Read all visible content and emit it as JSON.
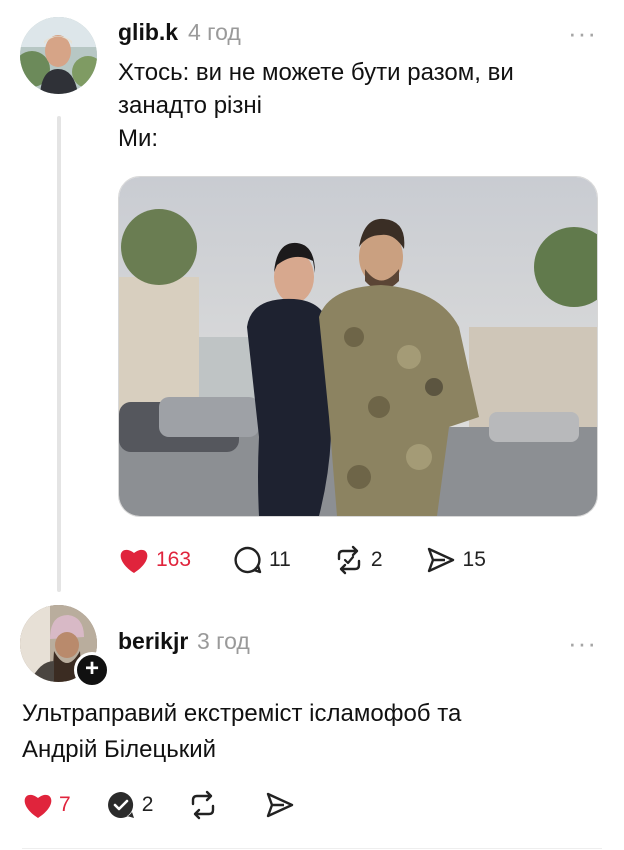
{
  "post1": {
    "username": "glib.k",
    "time": "4 год",
    "more": "···",
    "text_lines": [
      "Хтось: ви не можете бути разом, ви",
      "занадто різні",
      "Ми:"
    ],
    "likes": "163",
    "replies": "11",
    "reposts": "2",
    "shares": "15"
  },
  "post2": {
    "username": "berikjr",
    "time": "3 год",
    "more": "···",
    "follow": "+",
    "text_lines": [
      "Ультраправий екстреміст ісламофоб та",
      "Андрій Білецький"
    ],
    "likes": "7",
    "replies": "2"
  },
  "colors": {
    "like": "#e0243c",
    "meta": "#9a9a9a",
    "text": "#111111"
  }
}
